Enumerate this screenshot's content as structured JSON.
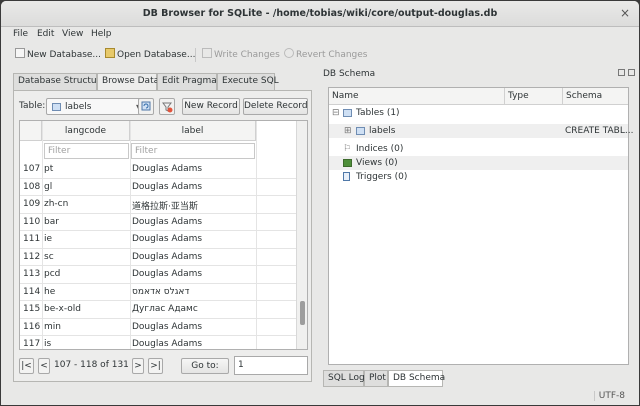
{
  "window": {
    "title": "DB Browser for SQLite - /home/tobias/wiki/core/output-douglas.db",
    "close_glyph": "×"
  },
  "menu": [
    "File",
    "Edit",
    "View",
    "Help"
  ],
  "toolbar": {
    "new_database": "New Database...",
    "open_database": "Open Database...",
    "write_changes": "Write Changes",
    "revert_changes": "Revert Changes"
  },
  "tabs": [
    "Database Structure",
    "Browse Data",
    "Edit Pragmas",
    "Execute SQL"
  ],
  "browse": {
    "table_label": "Table:",
    "table_value": "labels",
    "new_record": "New Record",
    "delete_record": "Delete Record",
    "columns": [
      "langcode",
      "label"
    ],
    "filter_placeholder": "Filter",
    "rows": [
      {
        "n": "107",
        "langcode": "pt",
        "label": "Douglas Adams"
      },
      {
        "n": "108",
        "langcode": "gl",
        "label": "Douglas Adams"
      },
      {
        "n": "109",
        "langcode": "zh-cn",
        "label": "道格拉斯·亚当斯"
      },
      {
        "n": "110",
        "langcode": "bar",
        "label": "Douglas Adams"
      },
      {
        "n": "111",
        "langcode": "ie",
        "label": "Douglas Adams"
      },
      {
        "n": "112",
        "langcode": "sc",
        "label": "Douglas Adams"
      },
      {
        "n": "113",
        "langcode": "pcd",
        "label": "Douglas Adams"
      },
      {
        "n": "114",
        "langcode": "he",
        "label": "דאגלס אדאמס"
      },
      {
        "n": "115",
        "langcode": "be-x-old",
        "label": "Дуглас Адамс"
      },
      {
        "n": "116",
        "langcode": "min",
        "label": "Douglas Adams"
      },
      {
        "n": "117",
        "langcode": "is",
        "label": "Douglas Adams"
      }
    ],
    "nav_first": "|<",
    "nav_prev": "<",
    "nav_range": "107 - 118 of 131",
    "nav_next": ">",
    "nav_last": ">|",
    "goto_label": "Go to:",
    "goto_value": "1"
  },
  "schema": {
    "dock_title": "DB Schema",
    "headers": [
      "Name",
      "Type",
      "Schema"
    ],
    "tree": [
      {
        "name": "Tables (1)",
        "type": "",
        "schema": ""
      },
      {
        "name": "labels",
        "type": "",
        "schema": "CREATE TABL..."
      },
      {
        "name": "Indices (0)",
        "type": "",
        "schema": ""
      },
      {
        "name": "Views (0)",
        "type": "",
        "schema": ""
      },
      {
        "name": "Triggers (0)",
        "type": "",
        "schema": ""
      }
    ],
    "expander_minus": "⊟",
    "expander_plus": "⊞"
  },
  "dock_tabs": [
    "SQL Log",
    "Plot",
    "DB Schema"
  ],
  "status": {
    "encoding": "UTF-8"
  },
  "colors": {
    "table_icon": "#cfe0f4",
    "view_icon": "#4e8f3a"
  }
}
